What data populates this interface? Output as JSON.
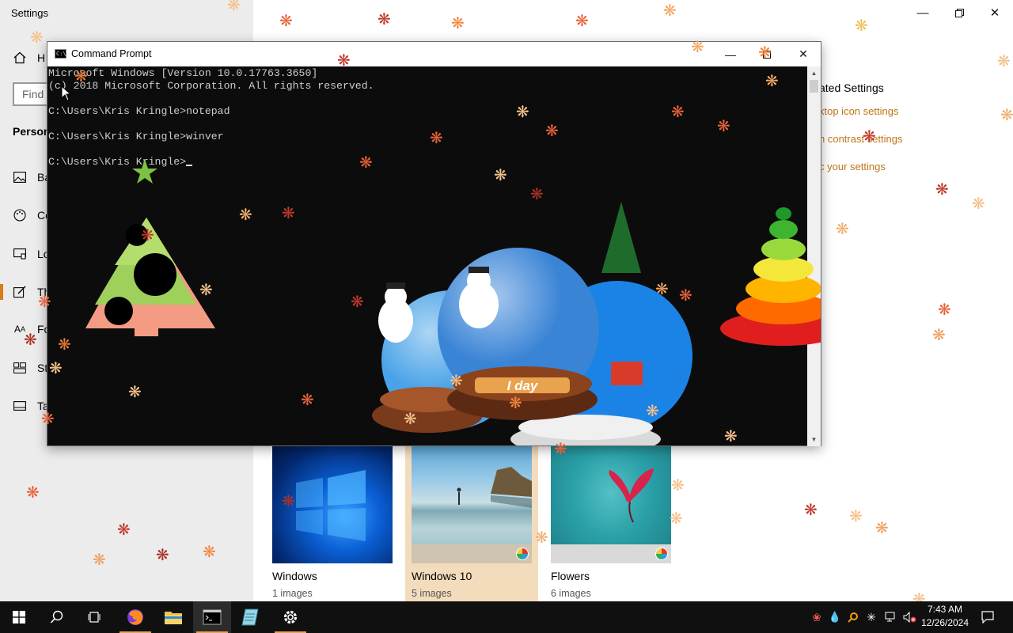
{
  "settings": {
    "app_title": "Settings",
    "find_placeholder": "Find",
    "section_heading": "Person",
    "nav_home": "H",
    "nav": [
      {
        "label": "Ba",
        "icon": "image-icon"
      },
      {
        "label": "Co",
        "icon": "palette-icon"
      },
      {
        "label": "Lo",
        "icon": "lock-screen-icon"
      },
      {
        "label": "Th",
        "icon": "themes-icon",
        "selected": true
      },
      {
        "label": "Fo",
        "icon": "fonts-icon"
      },
      {
        "label": "St",
        "icon": "start-icon"
      },
      {
        "label": "Ta",
        "icon": "taskbar-icon"
      }
    ],
    "related": {
      "title": "ated Settings",
      "links": [
        "ktop icon settings",
        "h contrast settings",
        "c your settings"
      ]
    },
    "themes": [
      {
        "name": "Windows",
        "count": "1 images"
      },
      {
        "name": "Windows 10",
        "count": "5 images",
        "selected": true
      },
      {
        "name": "Flowers",
        "count": "6 images"
      }
    ],
    "accent_color": "#d77c1f"
  },
  "cmd": {
    "title": "Command Prompt",
    "lines": [
      "Microsoft Windows [Version 10.0.17763.3650]",
      "(c) 2018 Microsoft Corporation. All rights reserved.",
      "",
      "C:\\Users\\Kris Kringle>notepad",
      "",
      "C:\\Users\\Kris Kringle>winver",
      "",
      "C:\\Users\\Kris Kringle>"
    ],
    "globe_label": "I day"
  },
  "taskbar": {
    "time": "7:43 AM",
    "date": "12/26/2024",
    "apps": [
      "start-icon",
      "search-icon",
      "task-view-icon",
      "firefox-icon",
      "file-explorer-icon",
      "command-prompt-icon",
      "notepad-icon",
      "settings-icon"
    ]
  }
}
